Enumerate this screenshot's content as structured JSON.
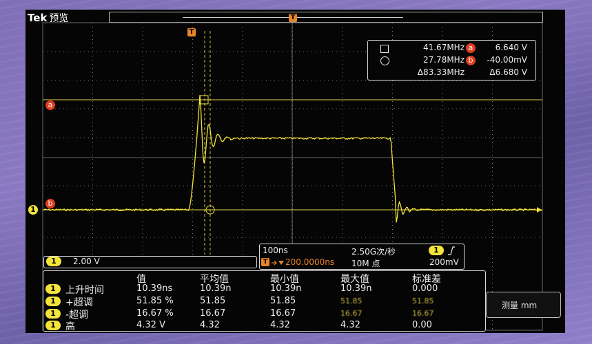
{
  "header": {
    "brand": "Tek",
    "mode": "预览"
  },
  "markers": {
    "trigger": "T",
    "cursor_a": "a",
    "cursor_b": "b",
    "channel": "1"
  },
  "cursors": {
    "row1": {
      "freq": "41.67MHz",
      "label": "a",
      "value": "6.640 V"
    },
    "row2": {
      "freq": "27.78MHz",
      "label": "b",
      "value": "-40.00mV"
    },
    "row3": {
      "delta_freq": "Δ83.33MHz",
      "delta_value": "Δ6.680 V"
    }
  },
  "channel_box": {
    "channel": "1",
    "scale": "2.00 V"
  },
  "acquisition": {
    "timebase": "100ns",
    "sample_rate": "2.50G次/秒",
    "channel": "1",
    "slope_icon": "rising-edge-icon",
    "trigger_label": "T",
    "trigger_position": "200.0000ns",
    "record_length": "10M 点",
    "trigger_level": "200mV"
  },
  "measurements": {
    "headers": [
      "值",
      "平均值",
      "最小值",
      "最大值",
      "标准差"
    ],
    "rows": [
      {
        "channel": "1",
        "name": "上升时间",
        "value": "10.39ns",
        "mean": "10.39n",
        "min": "10.39n",
        "max": "10.39n",
        "std": "0.000"
      },
      {
        "channel": "1",
        "name": "+超调",
        "value": "51.85 %",
        "mean": "51.85",
        "min": "51.85",
        "max": "51.85",
        "std": "51.85"
      },
      {
        "channel": "1",
        "name": "-超调",
        "value": "16.67 %",
        "mean": "16.67",
        "min": "16.67",
        "max": "16.67",
        "std": "16.67"
      },
      {
        "channel": "1",
        "name": "高",
        "value": "4.32 V",
        "mean": "4.32",
        "min": "4.32",
        "max": "4.32",
        "std": "0.00"
      }
    ]
  },
  "side_button": {
    "label": "测量 mm"
  },
  "colors": {
    "trace": "#f4e43a",
    "grid": "#9a9a9a",
    "cursor_line": "#e6d24a",
    "trigger_marker": "#e8842a",
    "cursor_label": "#e23d1f",
    "screen_bg": "#050505"
  }
}
